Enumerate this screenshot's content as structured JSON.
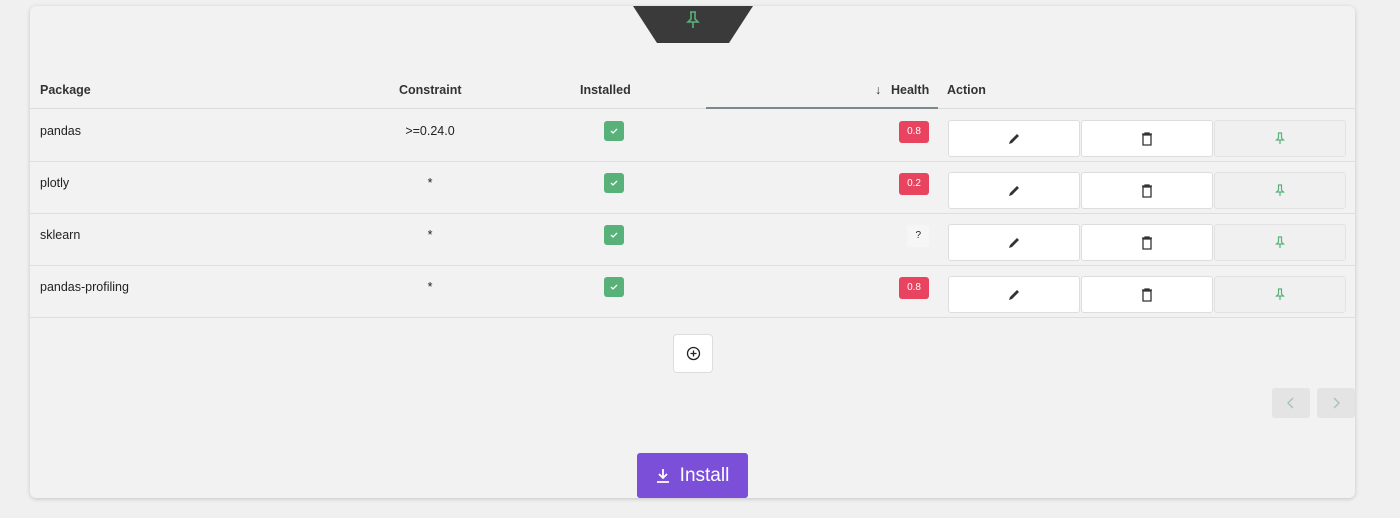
{
  "table": {
    "headers": {
      "package": "Package",
      "constraint": "Constraint",
      "installed": "Installed",
      "health_sort_icon": "↓",
      "health": "Health",
      "action": "Action"
    },
    "rows": [
      {
        "package": "pandas",
        "constraint": ">=0.24.0",
        "installed": true,
        "health": "0.8",
        "health_state": "bad"
      },
      {
        "package": "plotly",
        "constraint": "*",
        "installed": true,
        "health": "0.2",
        "health_state": "bad"
      },
      {
        "package": "sklearn",
        "constraint": "*",
        "installed": true,
        "health": "?",
        "health_state": "unknown"
      },
      {
        "package": "pandas-profiling",
        "constraint": "*",
        "installed": true,
        "health": "0.8",
        "health_state": "bad"
      }
    ]
  },
  "footer": {
    "install_label": "Install"
  },
  "colors": {
    "installed_green": "#58b179",
    "health_bad": "#e8445f",
    "install_purple": "#7b4fd8",
    "pin_green": "#58b179"
  },
  "icons": {
    "pin": "pin-icon",
    "edit": "pencil-icon",
    "delete": "trash-icon",
    "add": "plus-circle-icon",
    "prev": "chevron-left-icon",
    "next": "chevron-right-icon",
    "install": "download-icon",
    "check": "check-icon"
  }
}
